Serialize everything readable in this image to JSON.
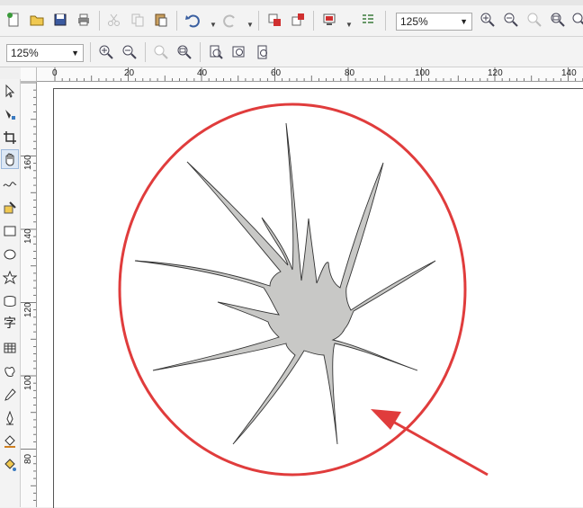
{
  "toolbar": {
    "zoom_value": "125%"
  },
  "property_bar": {
    "zoom_value": "125%"
  },
  "ruler_horizontal": {
    "labels": [
      "0",
      "20",
      "40",
      "60",
      "80",
      "100",
      "120",
      "140"
    ]
  },
  "ruler_vertical": {
    "labels": [
      "160",
      "140",
      "120",
      "100",
      "80"
    ]
  },
  "toolbox": {
    "text_tool_glyph": "字"
  },
  "colors": {
    "circle": "#e03c3c",
    "arrow": "#e03c3c",
    "shape_fill": "#c8c8c6",
    "shape_stroke": "#333333"
  }
}
